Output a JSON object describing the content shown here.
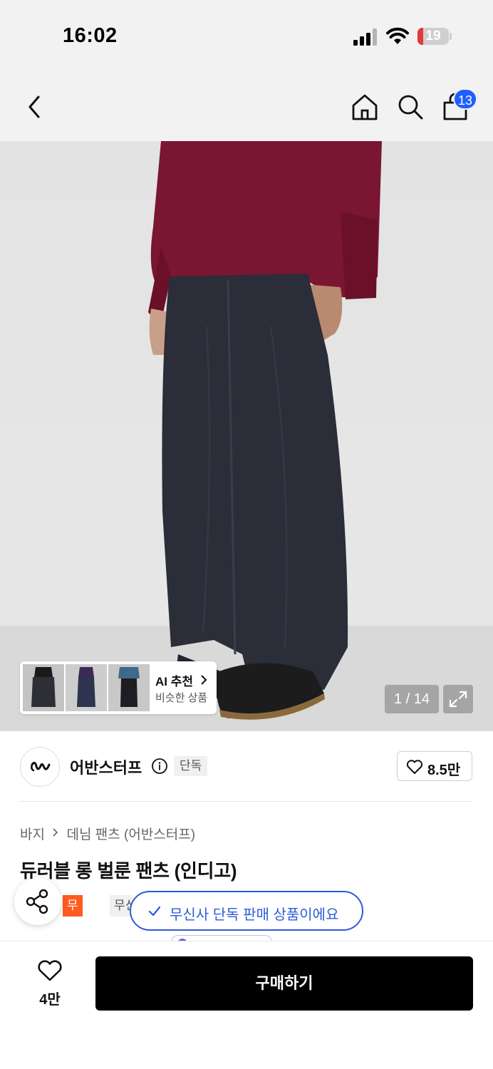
{
  "status_bar": {
    "time": "16:02",
    "battery_level": "19",
    "battery_fraction": 0.19
  },
  "nav": {
    "cart_count": "13"
  },
  "gallery": {
    "ai_card": {
      "title": "AI 추천",
      "subtitle": "비슷한 상품"
    },
    "counter": "1 / 14"
  },
  "brand": {
    "name": "어반스터프",
    "tag": "단독",
    "likes": "8.5만"
  },
  "product": {
    "breadcrumb": [
      "바지",
      "데님 팬츠 (어반스터프)"
    ],
    "title": "듀러블 롱 벌룬 팬츠 (인디고)",
    "badges": [
      "무진장",
      "무신"
    ]
  },
  "toast": {
    "message": "무신사 단독 판매 상품이에요"
  },
  "bottom_bar": {
    "wish_count": "4만",
    "buy_label": "구매하기"
  },
  "colors": {
    "accent_blue": "#1f5eff",
    "toast_blue": "#2b5bd7",
    "badge_orange": "#ff5a1f",
    "battery_red": "#e5383b",
    "buy_black": "#000000"
  }
}
